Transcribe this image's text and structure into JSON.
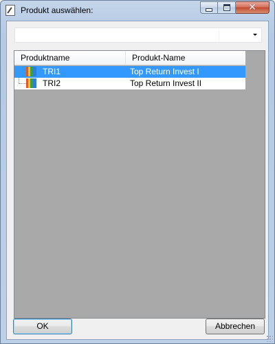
{
  "window": {
    "title": "Produkt auswählen:",
    "icon": "product-picker-icon",
    "controls": {
      "minimize_icon": "minimize-icon",
      "maximize_icon": "maximize-icon",
      "close_icon": "close-icon"
    }
  },
  "combo": {
    "value": "",
    "icon": "chevron-down-icon"
  },
  "tree": {
    "columns": [
      "Produktname",
      "Produkt-Name"
    ],
    "rows": [
      {
        "name": "TRI1",
        "description": "Top Return Invest I",
        "selected": true,
        "icon": "product-bars-icon"
      },
      {
        "name": "TRI2",
        "description": "Top Return Invest II",
        "selected": false,
        "icon": "product-bars-icon"
      }
    ],
    "colors": {
      "selection": "#3399ff",
      "empty_area": "#a9a9a9"
    }
  },
  "buttons": {
    "ok_label": "OK",
    "cancel_label": "Abbrechen"
  }
}
